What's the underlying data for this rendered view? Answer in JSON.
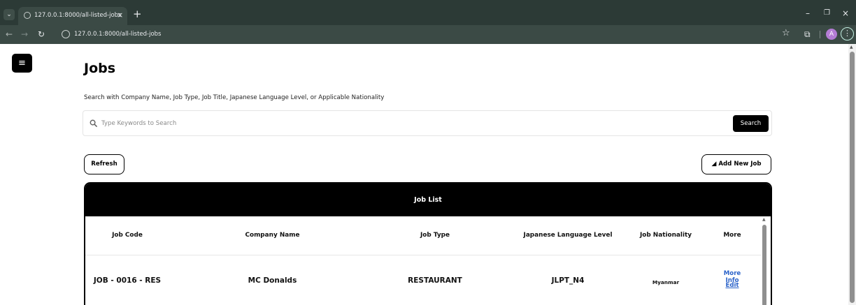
{
  "browser": {
    "tab_toggle": "⌄",
    "tab_title": "127.0.0.1:8000/all-listed-jobs",
    "tab_close": "×",
    "new_tab": "+",
    "minimize": "–",
    "restore": "❐",
    "close": "×",
    "back": "←",
    "forward": "→",
    "reload": "↻",
    "url": "127.0.0.1:8000/all-listed-jobs",
    "bookmark_star": "☆",
    "extensions": "⧉",
    "profile": "A",
    "menu": "⋮"
  },
  "page": {
    "menu_icon": "≡",
    "title": "Jobs",
    "search_hint": "Search with Company Name, Job Type, Job Title, Japanese Language Level, or Applicable Nationality",
    "search": {
      "placeholder": "Type Keywords to Search",
      "value": "",
      "button_label": "Search"
    },
    "refresh_label": "Refresh",
    "add_job_icon": "◢",
    "add_job_label": "Add New Job"
  },
  "table": {
    "title": "Job List",
    "columns": [
      "Job Code",
      "Company Name",
      "Job Type",
      "Japanese Language Level",
      "Job Nationality",
      "More"
    ],
    "rows": [
      {
        "job_code": "JOB - 0016 - RES",
        "company": "MC Donalds",
        "job_type": "RESTAURANT",
        "language_level": "JLPT_N4",
        "nationality": "Myanmar",
        "more_info": "More Info",
        "edit": "Edit"
      }
    ]
  },
  "icons": [
    "tab-list-icon",
    "globe-icon",
    "site-info-icon",
    "star-icon",
    "extensions-icon",
    "hamburger-icon",
    "search-icon",
    "paper-plane-icon",
    "kebab-menu-icon"
  ],
  "colors": {
    "chrome_bg": "#2c3a36",
    "toolbar_bg": "#3b4a45",
    "table_header_bg": "#000000",
    "link": "#2a62c9"
  }
}
